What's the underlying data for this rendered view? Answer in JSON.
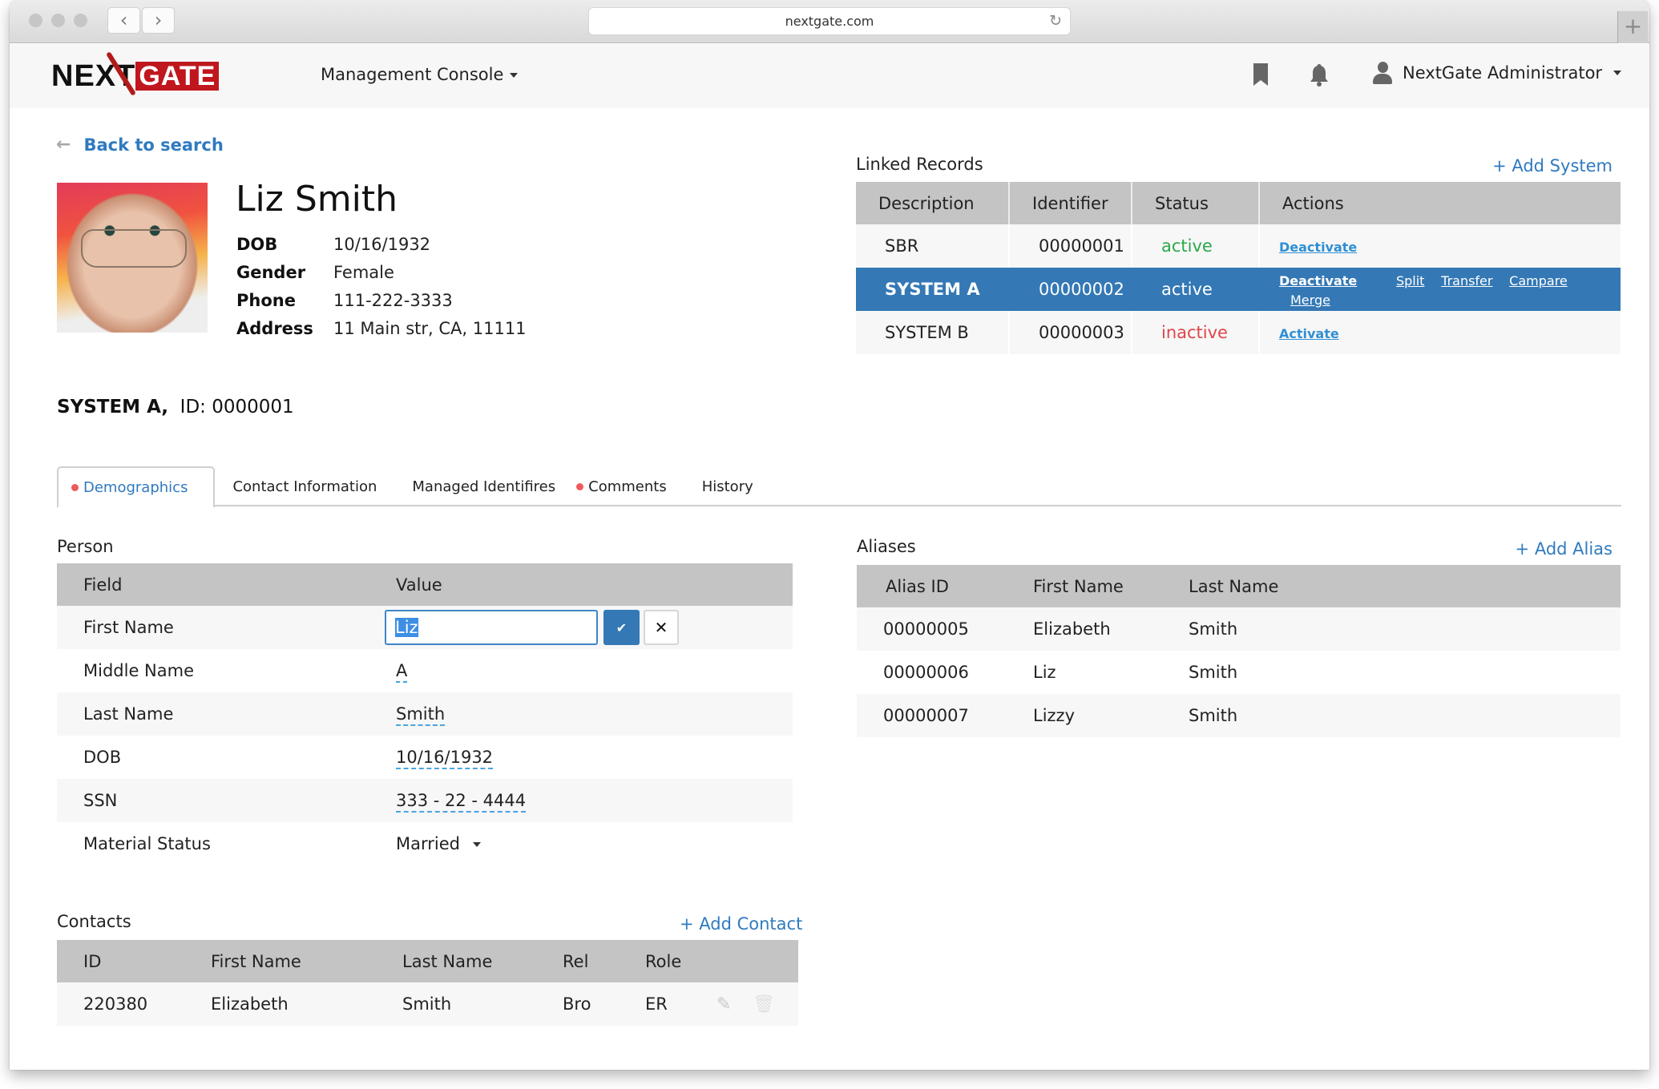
{
  "browser": {
    "url": "nextgate.com",
    "back_glyph": "‹",
    "forward_glyph": "›",
    "reload_glyph": "↻",
    "new_tab_glyph": "+"
  },
  "header": {
    "logo_left": "NEXT",
    "logo_right": "GATE",
    "console_menu": "Management Console",
    "user_name": "NextGate Administrator"
  },
  "profile": {
    "back_label": "Back to search",
    "back_glyph": "←",
    "name": "Liz Smith",
    "fields": [
      {
        "label": "DOB",
        "value": "10/16/1932"
      },
      {
        "label": "Gender",
        "value": "Female"
      },
      {
        "label": "Phone",
        "value": "111-222-3333"
      },
      {
        "label": "Address",
        "value": "11 Main  str, CA, 11111"
      }
    ]
  },
  "linked_records": {
    "title": "Linked Records",
    "add_label": "+ Add System",
    "columns": [
      "Description",
      "Identifier",
      "Status",
      "Actions"
    ],
    "rows": [
      {
        "description": "SBR",
        "identifier": "00000001",
        "status": "active",
        "primary_action": "Deactivate"
      },
      {
        "description": "SYSTEM A",
        "identifier": "00000002",
        "status": "active",
        "primary_action": "Deactivate",
        "extra_actions": [
          "Split",
          "Transfer",
          "Campare",
          "Merge"
        ],
        "selected": true
      },
      {
        "description": "SYSTEM B",
        "identifier": "00000003",
        "status": "inactive",
        "primary_action": "Activate"
      }
    ]
  },
  "system_heading": {
    "system": "SYSTEM A,",
    "id": "ID: 0000001"
  },
  "tabs": [
    {
      "label": "Demographics",
      "active": true,
      "dot": true
    },
    {
      "label": "Contact Information",
      "active": false,
      "dot": false
    },
    {
      "label": "Managed Identifires",
      "active": false,
      "dot": false
    },
    {
      "label": "Comments",
      "active": false,
      "dot": true
    },
    {
      "label": "History",
      "active": false,
      "dot": false
    }
  ],
  "person": {
    "title": "Person",
    "columns": [
      "Field",
      "Value"
    ],
    "rows": [
      {
        "field": "First Name",
        "value": "Liz",
        "editing": true
      },
      {
        "field": "Middle Name",
        "value": "A"
      },
      {
        "field": "Last Name",
        "value": "Smith"
      },
      {
        "field": "DOB",
        "value": "10/16/1932"
      },
      {
        "field": "SSN",
        "value": "333 - 22 - 4444"
      },
      {
        "field": "Material Status",
        "value": "Married",
        "dropdown": true
      }
    ],
    "confirm_glyph": "✔",
    "cancel_glyph": "✕"
  },
  "aliases": {
    "title": "Aliases",
    "add_label": "+ Add Alias",
    "columns": [
      "Alias ID",
      "First Name",
      "Last Name"
    ],
    "rows": [
      {
        "id": "00000005",
        "first": "Elizabeth",
        "last": "Smith"
      },
      {
        "id": "00000006",
        "first": "Liz",
        "last": "Smith"
      },
      {
        "id": "00000007",
        "first": "Lizzy",
        "last": "Smith"
      }
    ]
  },
  "contacts": {
    "title": "Contacts",
    "add_label": "+ Add Contact",
    "columns": [
      "ID",
      "First Name",
      "Last Name",
      "Rel",
      "Role"
    ],
    "rows": [
      {
        "id": "220380",
        "first": "Elizabeth",
        "last": "Smith",
        "rel": "Bro",
        "role": "ER"
      }
    ],
    "edit_glyph": "✎",
    "delete_glyph": "🗑"
  },
  "colors": {
    "accent": "#2f7ac0",
    "selected_row": "#3478b5",
    "active_status": "#2ba84a",
    "inactive_status": "#e0454a",
    "tab_dot": "#ef5a5a",
    "logo_red": "#c0161d"
  }
}
